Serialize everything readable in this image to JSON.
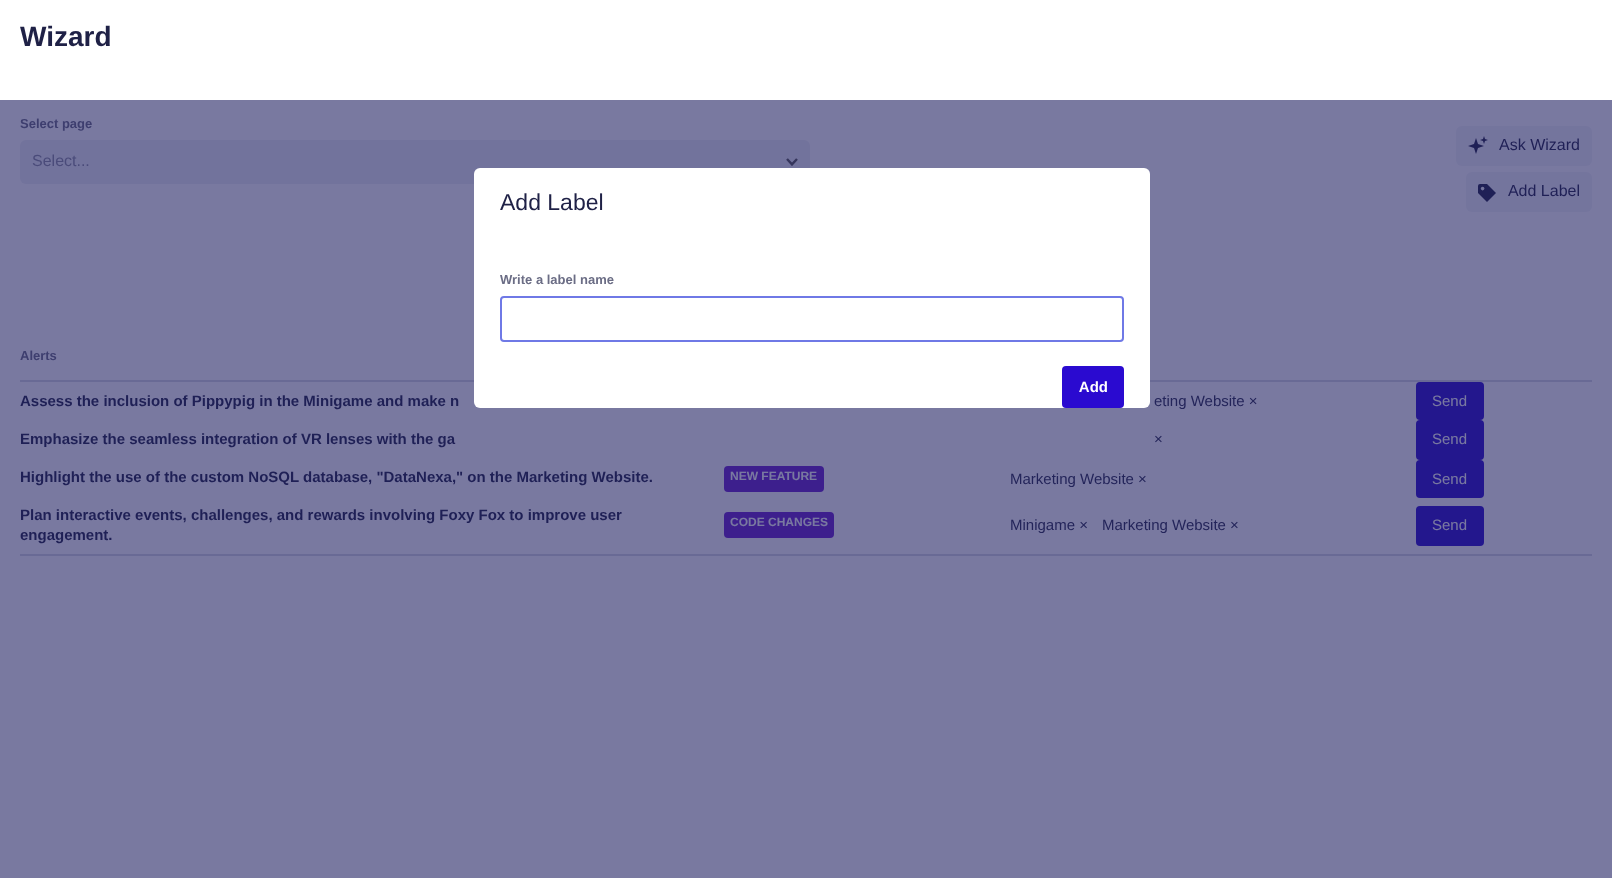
{
  "page": {
    "title": "Wizard"
  },
  "select": {
    "label": "Select page",
    "placeholder": "Select..."
  },
  "actions": [
    {
      "kind": "wizard",
      "label": "Ask Wizard"
    },
    {
      "kind": "label",
      "label": "Add Label"
    }
  ],
  "alerts": {
    "heading": "Alerts",
    "rows": [
      {
        "text": "Assess the inclusion of Pippypig in the Minigame and make n",
        "covered": true,
        "labels": [
          "eting Website ×"
        ],
        "send": "Send"
      },
      {
        "text": "Emphasize the seamless integration of VR lenses with the ga",
        "covered": true,
        "labels": [
          "×"
        ],
        "send": "Send"
      },
      {
        "text": "Highlight the use of the custom NoSQL database, \"DataNexa,\" on the Marketing Website.",
        "covered": false,
        "tag": "NEW FEATURE",
        "labels": [
          "Marketing Website ×"
        ],
        "send": "Send"
      },
      {
        "text": "Plan interactive events, challenges, and rewards involving Foxy Fox to improve user engagement.",
        "covered": false,
        "tag": "CODE CHANGES",
        "labels": [
          "Minigame ×",
          "Marketing Website ×"
        ],
        "send": "Send"
      }
    ]
  },
  "dialog": {
    "title": "Add Label",
    "field_label": "Write a label name",
    "button": "Add"
  }
}
